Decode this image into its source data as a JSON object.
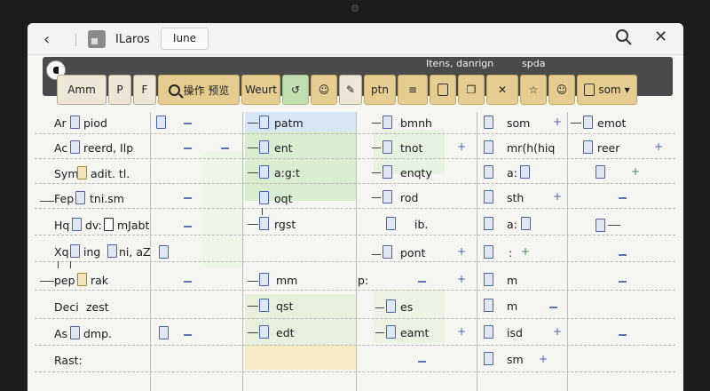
{
  "window": {
    "title": "ILaros",
    "tab": "Iune",
    "ribbon_right": "Itens, danrign",
    "ribbon_far": "spda"
  },
  "toolbar": {
    "b1": "Amm",
    "b2": "P",
    "b3": "F",
    "b4": "操作 预览",
    "b5": "Weurt",
    "b6": "ptn",
    "b7": "som"
  },
  "rows": {
    "r1": "Ar",
    "r1b": "piod",
    "r2": "Ac",
    "r2b": "reerd, Ilp",
    "r3": "Sym",
    "r3b": "adit. tl.",
    "r4": "Fep",
    "r4b": "tni.sm",
    "r5": "Hq",
    "r5b": "dv:",
    "r5c": "mJabt",
    "r6": "Xq",
    "r6b": "ing",
    "r6c": "ni, aZ",
    "r7": "pep",
    "r7b": "rak",
    "r8": "Deci",
    "r8b": "zest",
    "r9": "As",
    "r9b": "dmp.",
    "r10": "Rast:"
  },
  "col3": {
    "c1": "patm",
    "c2": "ent",
    "c3": "a:g:t",
    "c4": "oqt",
    "c5": "rgst",
    "c6": "mm",
    "c7": "qst",
    "c8": "edt"
  },
  "col4": {
    "c1": "bmnh",
    "c2": "tnot",
    "c3": "enqty",
    "c4": "rod",
    "c5": "ib.",
    "c6": "pont",
    "c7": "p:",
    "c8": "es",
    "c9": "eamt"
  },
  "col5": {
    "c1": "som",
    "c2": "mr(h(hiq",
    "c3": "a:",
    "c4": "sth",
    "c5": "a:",
    "c6": ":",
    "c7": "m",
    "c8": "m",
    "c9": "isd",
    "c10": "sm"
  },
  "col6": {
    "c1": "emot",
    "c2": "reer"
  }
}
